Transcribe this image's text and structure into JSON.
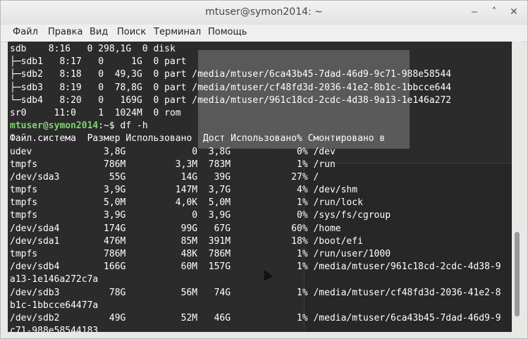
{
  "window": {
    "title": "mtuser@symon2014: ~",
    "buttons": {
      "minimize": "‒",
      "maximize": "˄",
      "close": "✕"
    }
  },
  "menu": [
    "Файл",
    "Правка",
    "Вид",
    "Поиск",
    "Терминал",
    "Помощь"
  ],
  "terminal": {
    "prompt_user": "mtuser@symon2014",
    "lines": [
      "sdb    8:16   0 298,1G  0 disk",
      "├─sdb1   8:17   0     1G  0 part",
      "├─sdb2   8:18   0  49,3G  0 part /media/mtuser/6ca43b45-7dad-46d9-9c71-988e58544",
      "├─sdb3   8:19   0  78,8G  0 part /media/mtuser/cf48fd3d-2036-41e2-8b1c-1bbcce644",
      "└─sdb4   8:20   0   169G  0 part /media/mtuser/961c18cd-2cdc-4d38-9a13-1e146a272",
      "sr0     11:0    1  1024M  0 rom",
      "__PROMPT__:~$ df -h",
      "Файл.система  Размер Использовано  Дост Использовано% Смонтировано в",
      "udev             3,8G            0  3,8G            0% /dev",
      "tmpfs            786M         3,3M  783M            1% /run",
      "/dev/sda3         55G          14G   39G           27% /",
      "tmpfs            3,9G         147M  3,7G            4% /dev/shm",
      "tmpfs            5,0M         4,0K  5,0M            1% /run/lock",
      "tmpfs            3,9G            0  3,9G            0% /sys/fs/cgroup",
      "/dev/sda4        174G          99G   67G           60% /home",
      "/dev/sda1        476M          85M  391M           18% /boot/efi",
      "tmpfs            786M          48K  786M            1% /run/user/1000",
      "/dev/sdb4        166G          60M  157G            1% /media/mtuser/961c18cd-2cdc-4d38-9",
      "a13-1e146a272c7a",
      "/dev/sdb3         78G          56M   74G            1% /media/mtuser/cf48fd3d-2036-41e2-8",
      "b1c-1bbcce64477a",
      "/dev/sdb2         49G          52M   46G            1% /media/mtuser/6ca43b45-7dad-46d9-9",
      "c71-988e58544183",
      "__PROMPT__:~$ "
    ]
  }
}
